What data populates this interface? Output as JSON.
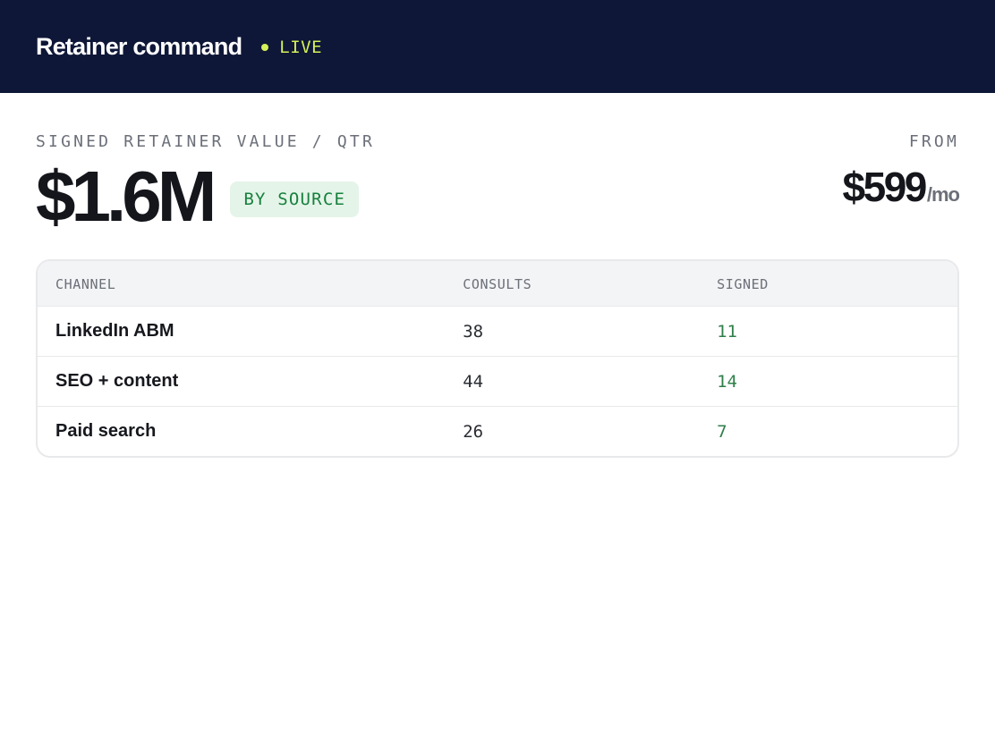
{
  "header": {
    "title": "Retainer command",
    "status": "LIVE",
    "status_color": "#d5f05a",
    "background": "#0e1737"
  },
  "kpi": {
    "label": "SIGNED RETAINER VALUE / QTR",
    "value": "$1.6M",
    "badge": "BY SOURCE"
  },
  "pricing": {
    "label": "FROM",
    "value": "$599",
    "unit": "/mo"
  },
  "table": {
    "columns": [
      "CHANNEL",
      "CONSULTS",
      "SIGNED"
    ],
    "rows": [
      {
        "channel": "LinkedIn ABM",
        "consults": "38",
        "signed": "11"
      },
      {
        "channel": "SEO + content",
        "consults": "44",
        "signed": "14"
      },
      {
        "channel": "Paid search",
        "consults": "26",
        "signed": "7"
      }
    ]
  },
  "colors": {
    "accent_green": "#17803d",
    "badge_bg": "#e5f4e9",
    "muted": "#6b6f78"
  }
}
